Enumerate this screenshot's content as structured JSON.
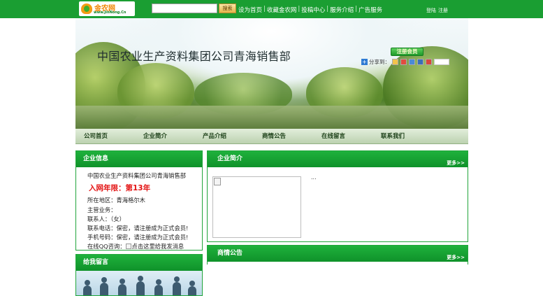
{
  "topbar": {
    "logo_name": "金农网",
    "logo_url": "www.JinNong.Cn",
    "search_placeholder": "",
    "search_button": "搜索",
    "links": [
      "设为首页",
      "收藏金农网",
      "投稿中心",
      "服务介绍",
      "广告服务"
    ],
    "separator": "|",
    "login": "登陆",
    "register": "注册"
  },
  "banner": {
    "company_name": "中国农业生产资料集团公司青海销售部",
    "register_button": "注册会员",
    "share_label": "分享到："
  },
  "nav": {
    "items": [
      "公司首页",
      "企业简介",
      "产品介绍",
      "商情公告",
      "在线留言",
      "联系我们"
    ]
  },
  "company_info": {
    "title": "企业信息",
    "company_name": "中国农业生产资料集团公司青海销售部",
    "years_label": "入网年限：第13年",
    "region": "所在地区：青海格尔木",
    "business": "主营业务：",
    "contact": "联系人：（女）",
    "phone": "联系电话：保密，请注册成为正式会员!",
    "mobile": "手机号码：保密，请注册成为正式会员!",
    "qq_prefix": "在线QQ咨询：",
    "qq_alt": "点击这里给我发消息"
  },
  "message_panel": {
    "title": "给我留言"
  },
  "intro_panel": {
    "title": "企业简介",
    "more": "更多>>",
    "text": "..."
  },
  "news_panel": {
    "title": "商情公告",
    "more": "更多>>"
  },
  "colors": {
    "brand_green": "#1a9e32",
    "panel_green": "#0f922a",
    "years_red": "#e31212"
  }
}
